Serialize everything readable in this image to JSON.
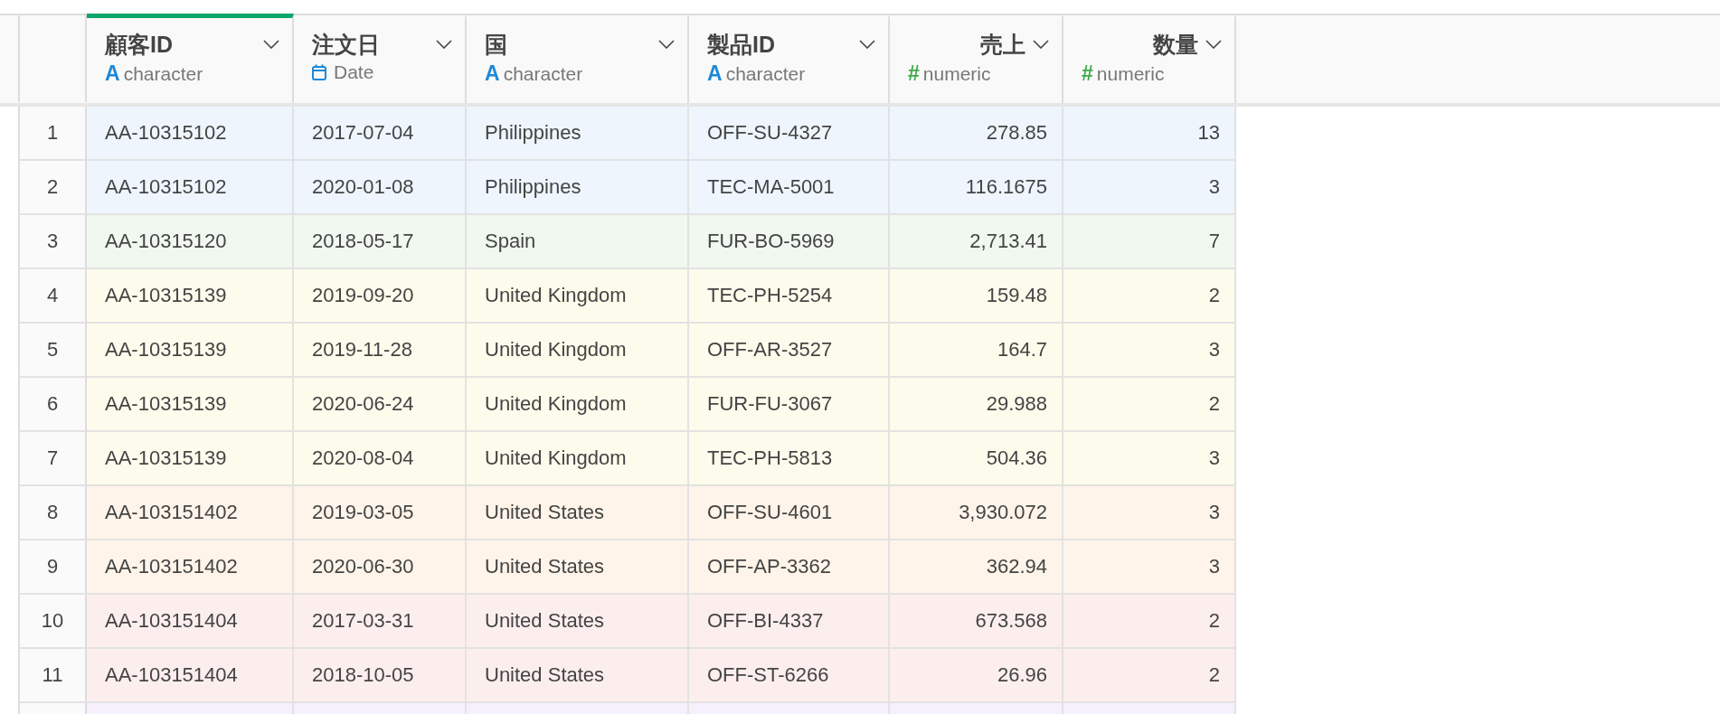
{
  "columns": [
    {
      "name": "顧客ID",
      "type": "character",
      "kind": "text",
      "icon": "A",
      "selected": true
    },
    {
      "name": "注文日",
      "type": "Date",
      "kind": "date",
      "selected": false
    },
    {
      "name": "国",
      "type": "character",
      "kind": "text",
      "icon": "A",
      "selected": false
    },
    {
      "name": "製品ID",
      "type": "character",
      "kind": "text",
      "icon": "A",
      "selected": false
    },
    {
      "name": "売上",
      "type": "numeric",
      "kind": "number",
      "icon": "#",
      "selected": false
    },
    {
      "name": "数量",
      "type": "numeric",
      "kind": "number",
      "icon": "#",
      "selected": false
    }
  ],
  "rows": [
    {
      "index": "1",
      "color": "#eef5fd",
      "cells": [
        "AA-10315102",
        "2017-07-04",
        "Philippines",
        "OFF-SU-4327",
        "278.85",
        "13"
      ]
    },
    {
      "index": "2",
      "color": "#eef5fd",
      "cells": [
        "AA-10315102",
        "2020-01-08",
        "Philippines",
        "TEC-MA-5001",
        "116.1675",
        "3"
      ]
    },
    {
      "index": "3",
      "color": "#f0f8ef",
      "cells": [
        "AA-10315120",
        "2018-05-17",
        "Spain",
        "FUR-BO-5969",
        "2,713.41",
        "7"
      ]
    },
    {
      "index": "4",
      "color": "#fdfcec",
      "cells": [
        "AA-10315139",
        "2019-09-20",
        "United Kingdom",
        "TEC-PH-5254",
        "159.48",
        "2"
      ]
    },
    {
      "index": "5",
      "color": "#fdfcec",
      "cells": [
        "AA-10315139",
        "2019-11-28",
        "United Kingdom",
        "OFF-AR-3527",
        "164.7",
        "3"
      ]
    },
    {
      "index": "6",
      "color": "#fdfcec",
      "cells": [
        "AA-10315139",
        "2020-06-24",
        "United Kingdom",
        "FUR-FU-3067",
        "29.988",
        "2"
      ]
    },
    {
      "index": "7",
      "color": "#fdfcec",
      "cells": [
        "AA-10315139",
        "2020-08-04",
        "United Kingdom",
        "TEC-PH-5813",
        "504.36",
        "3"
      ]
    },
    {
      "index": "8",
      "color": "#fef4e9",
      "cells": [
        "AA-103151402",
        "2019-03-05",
        "United States",
        "OFF-SU-4601",
        "3,930.072",
        "3"
      ]
    },
    {
      "index": "9",
      "color": "#fef4e9",
      "cells": [
        "AA-103151402",
        "2020-06-30",
        "United States",
        "OFF-AP-3362",
        "362.94",
        "3"
      ]
    },
    {
      "index": "10",
      "color": "#fdeeee",
      "cells": [
        "AA-103151404",
        "2017-03-31",
        "United States",
        "OFF-BI-4337",
        "673.568",
        "2"
      ]
    },
    {
      "index": "11",
      "color": "#fdeeee",
      "cells": [
        "AA-103151404",
        "2018-10-05",
        "United States",
        "OFF-ST-6266",
        "26.96",
        "2"
      ]
    },
    {
      "color": "#f6f0fc"
    }
  ]
}
